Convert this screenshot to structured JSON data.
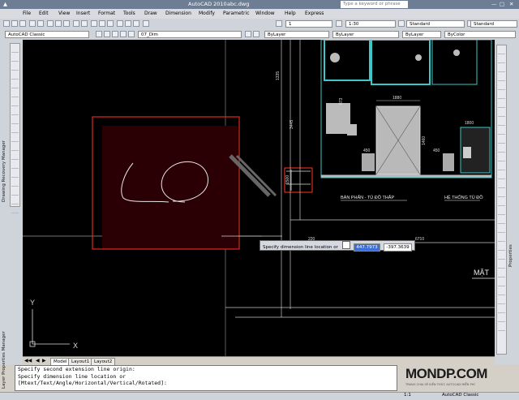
{
  "window": {
    "app_title": "AutoCAD 2010",
    "file_name": "abc.dwg",
    "search_placeholder": "Type a keyword or phrase"
  },
  "menu": [
    "File",
    "Edit",
    "View",
    "Insert",
    "Format",
    "Tools",
    "Draw",
    "Dimension",
    "Modify",
    "Parametric",
    "Window",
    "Help",
    "Express"
  ],
  "toolbar": {
    "workspace": "AutoCAD Classic",
    "layer": "07_Dim",
    "scale_value": "1",
    "annotation_scale": "1:30",
    "text_style": "Standard",
    "dim_style": "Standard",
    "color": "ByLayer",
    "linetype": "ByLayer",
    "lineweight": "ByLayer",
    "plot_style": "ByColor"
  },
  "side_palettes": {
    "left_top": "Drawing Recovery Manager",
    "left_bottom": "Layer Properties Manager",
    "right": "Properties"
  },
  "drawing": {
    "dims": {
      "d1335": "1335",
      "d3445": "3445",
      "d1880": "1880",
      "d450a": "450",
      "d450b": "450",
      "d873": "873",
      "d1460": "1460",
      "d1800": "1800",
      "d220": "220",
      "d6710": "6710",
      "d1500": "1500"
    },
    "labels": {
      "left": "BÀN PHẤN - TỦ ĐỒ THẤP",
      "right": "HỆ THỐNG TỦ ĐỒ",
      "mat": "MẶT"
    },
    "ucs": {
      "y": "Y",
      "x": "X"
    }
  },
  "dynamic_input": {
    "prompt": "Specify dimension line location or",
    "value1": "447.7973",
    "value2": "-397.3639"
  },
  "tabs": [
    "Model",
    "Layout1",
    "Layout2"
  ],
  "command_lines": [
    "Specify second extension line origin:",
    "Specify dimension line location or",
    "[Mtext/Text/Angle/Horizontal/Vertical/Rotated]:"
  ],
  "watermark": {
    "brand": "MONDP.COM",
    "tagline": "TRANG CHIA SẺ KIẾN THỨC AUTOCAD MIỄN PHÍ"
  },
  "status": {
    "scale": "1:1",
    "workspace": "AutoCAD Classic"
  },
  "colors": {
    "highlight_box": "#e0281e",
    "canvas": "#000000",
    "wall_cyan": "#3ec7c7",
    "dim_line": "#d0d0d0",
    "dyn_selected": "#3a6fd8"
  }
}
